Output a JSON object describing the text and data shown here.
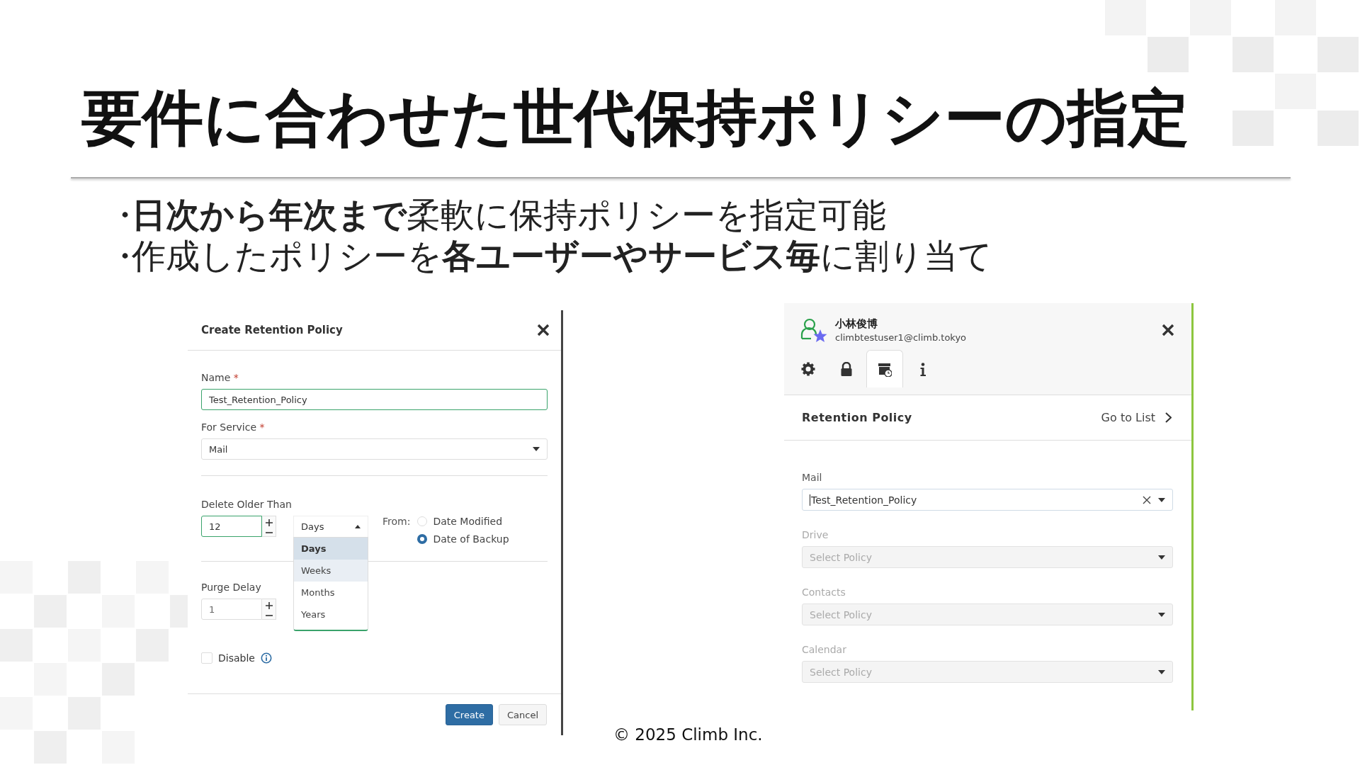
{
  "slide": {
    "title": "要件に合わせた世代保持ポリシーの指定",
    "bullet_mark": "・",
    "bullets": [
      "**日次から年次まで**柔軟に保持ポリシーを指定可能",
      "作成したポリシーを**各ユーザーやサービス毎**に割り当て"
    ],
    "footer": "© 2025 Climb Inc."
  },
  "create_dialog": {
    "title": "Create Retention Policy",
    "name_field": {
      "label": "Name",
      "required": true,
      "required_mark": "*",
      "value": "Test_Retention_Policy",
      "focused": true
    },
    "service_field": {
      "label": "For Service",
      "required": true,
      "required_mark": "*",
      "value": "Mail"
    },
    "delete_older_than": {
      "label": "Delete Older Than",
      "value": "12",
      "unit": "Days",
      "expanded": true,
      "unit_options": [
        {
          "label": "Days",
          "selected": true,
          "hovered": false
        },
        {
          "label": "Weeks",
          "selected": false,
          "hovered": true
        },
        {
          "label": "Months",
          "selected": false,
          "hovered": false
        },
        {
          "label": "Years",
          "selected": false,
          "hovered": false
        }
      ],
      "from_label": "From:",
      "from_options": [
        {
          "label": "Date Modified",
          "selected": false
        },
        {
          "label": "Date of Backup",
          "selected": true
        }
      ]
    },
    "purge_delay": {
      "label": "Purge Delay",
      "value": "1"
    },
    "disable": {
      "label": "Disable",
      "checked": false
    },
    "buttons": [
      {
        "label": "Create",
        "kind": "primary"
      },
      {
        "label": "Cancel",
        "kind": "secondary"
      }
    ]
  },
  "user_panel": {
    "user": {
      "name": "小林俊博",
      "email": "climbtestuser1@climb.tokyo"
    },
    "tabs": [
      {
        "kind": "settings",
        "selected": false
      },
      {
        "kind": "lock",
        "selected": false
      },
      {
        "kind": "archive",
        "selected": true
      },
      {
        "kind": "info",
        "selected": false
      }
    ],
    "section_title": "Retention Policy",
    "go_to_list": "Go to List",
    "policies": [
      {
        "service": "Mail",
        "value": "Test_Retention_Policy",
        "disabled": false
      },
      {
        "service": "Drive",
        "placeholder": "Select Policy",
        "disabled": true
      },
      {
        "service": "Contacts",
        "placeholder": "Select Policy",
        "disabled": true
      },
      {
        "service": "Calendar",
        "placeholder": "Select Policy",
        "disabled": true
      }
    ]
  }
}
